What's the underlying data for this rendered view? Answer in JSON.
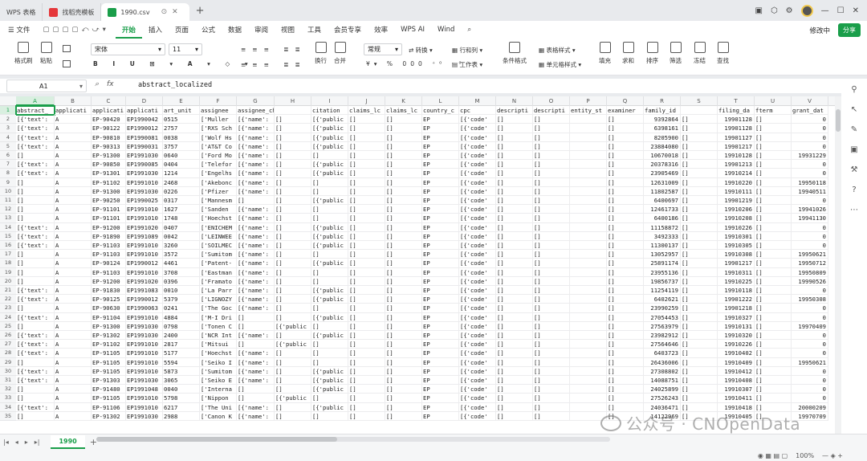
{
  "tabs": [
    {
      "label": "WPS 表格",
      "icon_color": "#e8eaed",
      "active": false
    },
    {
      "label": "找稻壳模板",
      "icon_color": "#e5383b",
      "active": false
    },
    {
      "label": "1990.csv",
      "icon_color": "#1a9e4a",
      "active": true
    }
  ],
  "new_tab": "+",
  "menu": {
    "file": "文件",
    "items": [
      "开始",
      "插入",
      "页面",
      "公式",
      "数据",
      "审阅",
      "视图",
      "工具",
      "会员专享",
      "效率",
      "WPS AI",
      "Wind"
    ],
    "active_index": 0,
    "edit_status": "修改中",
    "share": "分享"
  },
  "ribbon": {
    "groups": [
      "格式刷",
      "粘贴",
      "",
      "字体",
      "对齐",
      "换行",
      "合并",
      "常规",
      "转换",
      "行和列",
      "工作表",
      "条件格式",
      "表格样式",
      "单元格样式",
      "填充",
      "求和",
      "排序",
      "筛选",
      "冻结",
      "查找"
    ],
    "font_name": "宋体",
    "font_size": "11",
    "number_format": "常规",
    "convert": "转换"
  },
  "formula_bar": {
    "cell_ref": "A1",
    "formula": "abstract_localized"
  },
  "columns": [
    "A",
    "B",
    "C",
    "D",
    "E",
    "F",
    "G",
    "H",
    "I",
    "J",
    "K",
    "L",
    "M",
    "N",
    "O",
    "P",
    "Q",
    "R",
    "S",
    "T",
    "U",
    "V"
  ],
  "header_row": [
    "abstract_",
    "applicati",
    "applicati",
    "applicati",
    "art_unit",
    "assignee",
    "assignee_child",
    "",
    "citation",
    "claims_lc",
    "claims_lc",
    "country_c",
    "cpc",
    "descripti",
    "descripti",
    "entity_st",
    "examiner",
    "family_id",
    "",
    "filing_da",
    "fterm",
    "grant_dat"
  ],
  "rows": [
    [
      "[{'text':",
      "A",
      "EP-90420",
      "EP1990042",
      "0515",
      "['Muller",
      "[{'name':",
      "[]",
      "[{'public",
      "[]",
      "[]",
      "EP",
      "[{'code'",
      "[]",
      "[]",
      "",
      "[]",
      "9392864",
      "[]",
      "19901128",
      "[]",
      "0"
    ],
    [
      "[{'text':",
      "A",
      "EP-90122",
      "EP1990012",
      "2757",
      "['RXS Sch",
      "[{'name':",
      "[]",
      "[{'public",
      "[]",
      "[]",
      "EP",
      "[{'code'",
      "[]",
      "[]",
      "",
      "[]",
      "6398161",
      "[]",
      "19901128",
      "[]",
      "0"
    ],
    [
      "[{'text':",
      "A",
      "EP-90810",
      "EP1990081",
      "0038",
      "['Wolf Hs",
      "[{'name':",
      "[]",
      "[{'public",
      "[]",
      "[]",
      "EP",
      "[{'code'",
      "[]",
      "[]",
      "",
      "[]",
      "8205900",
      "[]",
      "19901127",
      "[]",
      "0"
    ],
    [
      "[{'text':",
      "A",
      "EP-90313",
      "EP1990031",
      "3757",
      "['AT&T Co",
      "[{'name':",
      "[]",
      "[{'public",
      "[]",
      "[]",
      "EP",
      "[{'code'",
      "[]",
      "[]",
      "",
      "[]",
      "23884080",
      "[]",
      "19901217",
      "[]",
      "0"
    ],
    [
      "[]",
      "A",
      "EP-91300",
      "EP1991030",
      "0640",
      "['Ford Mo",
      "[{'name':",
      "[]",
      "[]",
      "[]",
      "[]",
      "EP",
      "[{'code'",
      "[]",
      "[]",
      "",
      "[]",
      "10670018",
      "[]",
      "19910128",
      "[]",
      "19931229"
    ],
    [
      "[{'text':",
      "A",
      "EP-90850",
      "EP1990085",
      "0404",
      "['Telefor",
      "[{'name':",
      "[]",
      "[{'public",
      "[]",
      "[]",
      "EP",
      "[{'code'",
      "[]",
      "[]",
      "",
      "[]",
      "20378316",
      "[]",
      "19901213",
      "[]",
      "0"
    ],
    [
      "[{'text':",
      "A",
      "EP-91301",
      "EP1991030",
      "1214",
      "['Engelhs",
      "[{'name':",
      "[]",
      "[{'public",
      "[]",
      "[]",
      "EP",
      "[{'code'",
      "[]",
      "[]",
      "",
      "[]",
      "23905469",
      "[]",
      "19910214",
      "[]",
      "0"
    ],
    [
      "[]",
      "A",
      "EP-91102",
      "EP1991010",
      "2468",
      "['Akebonc",
      "[{'name':",
      "[]",
      "[]",
      "[]",
      "[]",
      "EP",
      "[{'code'",
      "[]",
      "[]",
      "",
      "[]",
      "12631009",
      "[]",
      "19910220",
      "[]",
      "19950118"
    ],
    [
      "[]",
      "A",
      "EP-91300",
      "EP1991030",
      "0226",
      "['Pfizer",
      "[{'name':",
      "[]",
      "[]",
      "[]",
      "[]",
      "EP",
      "[{'code'",
      "[]",
      "[]",
      "",
      "[]",
      "11802587",
      "[]",
      "19910111",
      "[]",
      "19940511"
    ],
    [
      "[]",
      "A",
      "EP-90250",
      "EP1990025",
      "0317",
      "['Mannesm",
      "[]",
      "[]",
      "[{'public",
      "[]",
      "[]",
      "EP",
      "[{'code'",
      "[]",
      "[]",
      "",
      "[]",
      "6400697",
      "[]",
      "19901219",
      "[]",
      "0"
    ],
    [
      "[]",
      "A",
      "EP-91101",
      "EP1991010",
      "1627",
      "['Sanden",
      "[{'name':",
      "[]",
      "[]",
      "[]",
      "[]",
      "EP",
      "[{'code'",
      "[]",
      "[]",
      "",
      "[]",
      "12461733",
      "[]",
      "19910206",
      "[]",
      "19941026"
    ],
    [
      "[]",
      "A",
      "EP-91101",
      "EP1991010",
      "1748",
      "['Hoechst",
      "[{'name':",
      "[]",
      "[]",
      "[]",
      "[]",
      "EP",
      "[{'code'",
      "[]",
      "[]",
      "",
      "[]",
      "6400186",
      "[]",
      "19910208",
      "[]",
      "19941130"
    ],
    [
      "[{'text':",
      "A",
      "EP-91200",
      "EP1991020",
      "0407",
      "['ENICHEM",
      "[{'name':",
      "[]",
      "[{'public",
      "[]",
      "[]",
      "EP",
      "[{'code'",
      "[]",
      "[]",
      "",
      "[]",
      "11158872",
      "[]",
      "19910226",
      "[]",
      "0"
    ],
    [
      "[{'text':",
      "A",
      "EP-91890",
      "EP1991089",
      "0042",
      "['LEINWEE",
      "[{'name':",
      "[]",
      "[{'public",
      "[]",
      "[]",
      "EP",
      "[{'code'",
      "[]",
      "[]",
      "",
      "[]",
      "3492333",
      "[]",
      "19910301",
      "[]",
      "0"
    ],
    [
      "[{'text':",
      "A",
      "EP-91103",
      "EP1991010",
      "3260",
      "['SOILMEC",
      "[{'name':",
      "[]",
      "[{'public",
      "[]",
      "[]",
      "EP",
      "[{'code'",
      "[]",
      "[]",
      "",
      "[]",
      "11300137",
      "[]",
      "19910305",
      "[]",
      "0"
    ],
    [
      "[]",
      "A",
      "EP-91103",
      "EP1991010",
      "3572",
      "['Sumitom",
      "[{'name':",
      "[]",
      "[]",
      "[]",
      "[]",
      "EP",
      "[{'code'",
      "[]",
      "[]",
      "",
      "[]",
      "13052957",
      "[]",
      "19910308",
      "[]",
      "19950621"
    ],
    [
      "[]",
      "A",
      "EP-90124",
      "EP1990012",
      "4461",
      "['Patent-",
      "[{'name':",
      "[]",
      "[{'public",
      "[]",
      "[]",
      "EP",
      "[{'code'",
      "[]",
      "[]",
      "",
      "[]",
      "25891174",
      "[]",
      "19901217",
      "[]",
      "19950712"
    ],
    [
      "[]",
      "A",
      "EP-91103",
      "EP1991010",
      "3708",
      "['Eastman",
      "[{'name':",
      "[]",
      "[]",
      "[]",
      "[]",
      "EP",
      "[{'code'",
      "[]",
      "[]",
      "",
      "[]",
      "23955136",
      "[]",
      "19910311",
      "[]",
      "19950809"
    ],
    [
      "[]",
      "A",
      "EP-91200",
      "EP1991020",
      "0396",
      "['Framato",
      "[{'name':",
      "[]",
      "[]",
      "[]",
      "[]",
      "EP",
      "[{'code'",
      "[]",
      "[]",
      "",
      "[]",
      "19856737",
      "[]",
      "19910225",
      "[]",
      "19990526"
    ],
    [
      "[{'text':",
      "A",
      "EP-91830",
      "EP1991083",
      "0010",
      "['La Parr",
      "[{'name':",
      "[]",
      "[{'public",
      "[]",
      "[]",
      "EP",
      "[{'code'",
      "[]",
      "[]",
      "",
      "[]",
      "11254119",
      "[]",
      "19910118",
      "[]",
      "0"
    ],
    [
      "[{'text':",
      "A",
      "EP-90125",
      "EP1990012",
      "5379",
      "['LIGNOZY",
      "[{'name':",
      "[]",
      "[{'public",
      "[]",
      "[]",
      "EP",
      "[{'code'",
      "[]",
      "[]",
      "",
      "[]",
      "6402621",
      "[]",
      "19901222",
      "[]",
      "19950308"
    ],
    [
      "[]",
      "A",
      "EP-90630",
      "EP1990063",
      "0241",
      "['The Goc",
      "[{'name':",
      "[]",
      "[]",
      "[]",
      "[]",
      "EP",
      "[{'code'",
      "[]",
      "[]",
      "",
      "[]",
      "23990259",
      "[]",
      "19901218",
      "[]",
      "0"
    ],
    [
      "[{'text':",
      "A",
      "EP-91104",
      "EP1991010",
      "4884",
      "['M-I Dri",
      "[]",
      "[]",
      "[{'public",
      "[]",
      "[]",
      "EP",
      "[{'code'",
      "[]",
      "[]",
      "",
      "[]",
      "27054453",
      "[]",
      "19910327",
      "[]",
      "0"
    ],
    [
      "[]",
      "A",
      "EP-91300",
      "EP1991030",
      "0798",
      "['Tonen C",
      "[]",
      "[{'public",
      "[]",
      "[]",
      "[]",
      "EP",
      "[{'code'",
      "[]",
      "[]",
      "",
      "[]",
      "27563979",
      "[]",
      "19910131",
      "[]",
      "19970409"
    ],
    [
      "[{'text':",
      "A",
      "EP-91302",
      "EP1991030",
      "2400",
      "['NCR Int",
      "[{'name':",
      "[]",
      "[{'public",
      "[]",
      "[]",
      "EP",
      "[{'code'",
      "[]",
      "[]",
      "",
      "[]",
      "23982912",
      "[]",
      "19910320",
      "[]",
      "0"
    ],
    [
      "[{'text':",
      "A",
      "EP-91102",
      "EP1991010",
      "2817",
      "['Mitsui",
      "[]",
      "[{'public",
      "[]",
      "[]",
      "[]",
      "EP",
      "[{'code'",
      "[]",
      "[]",
      "",
      "[]",
      "27564646",
      "[]",
      "19910226",
      "[]",
      "0"
    ],
    [
      "[{'text':",
      "A",
      "EP-91105",
      "EP1991010",
      "5177",
      "['Hoechst",
      "[{'name':",
      "[]",
      "[]",
      "[]",
      "[]",
      "EP",
      "[{'code'",
      "[]",
      "[]",
      "",
      "[]",
      "6403723",
      "[]",
      "19910402",
      "[]",
      "0"
    ],
    [
      "[]",
      "A",
      "EP-91105",
      "EP1991010",
      "5594",
      "['Seiko I",
      "[{'name':",
      "[]",
      "[]",
      "[]",
      "[]",
      "EP",
      "[{'code'",
      "[]",
      "[]",
      "",
      "[]",
      "26436006",
      "[]",
      "19910409",
      "[]",
      "19950621"
    ],
    [
      "[{'text':",
      "A",
      "EP-91105",
      "EP1991010",
      "5873",
      "['Sumitom",
      "[{'name':",
      "[]",
      "[{'public",
      "[]",
      "[]",
      "EP",
      "[{'code'",
      "[]",
      "[]",
      "",
      "[]",
      "27308802",
      "[]",
      "19910412",
      "[]",
      "0"
    ],
    [
      "[{'text':",
      "A",
      "EP-91303",
      "EP1991030",
      "3065",
      "['Seiko E",
      "[{'name':",
      "[]",
      "[{'public",
      "[]",
      "[]",
      "EP",
      "[{'code'",
      "[]",
      "[]",
      "",
      "[]",
      "14088751",
      "[]",
      "19910408",
      "[]",
      "0"
    ],
    [
      "[]",
      "A",
      "EP-91480",
      "EP1991048",
      "0040",
      "['Interna",
      "[]",
      "[]",
      "[{'public",
      "[]",
      "[]",
      "EP",
      "[{'code'",
      "[]",
      "[]",
      "",
      "[]",
      "24025899",
      "[]",
      "19910307",
      "[]",
      "0"
    ],
    [
      "[]",
      "A",
      "EP-91105",
      "EP1991010",
      "5798",
      "['Nippon",
      "[]",
      "[{'public",
      "[]",
      "[]",
      "[]",
      "EP",
      "[{'code'",
      "[]",
      "[]",
      "",
      "[]",
      "27526243",
      "[]",
      "19910411",
      "[]",
      "0"
    ],
    [
      "[{'text':",
      "A",
      "EP-91106",
      "EP1991010",
      "6217",
      "['The Uni",
      "[{'name':",
      "[]",
      "[{'public",
      "[]",
      "[]",
      "EP",
      "[{'code'",
      "[]",
      "[]",
      "",
      "[]",
      "24036471",
      "[]",
      "19910418",
      "[]",
      "20000209"
    ],
    [
      "[]",
      "A",
      "EP-91302",
      "EP1991030",
      "2988",
      "['Canon K",
      "[{'name':",
      "[]",
      "[]",
      "[]",
      "[]",
      "EP",
      "[{'code'",
      "[]",
      "[]",
      "",
      "[]",
      "14122969",
      "[]",
      "19910405",
      "[]",
      "19970709"
    ]
  ],
  "sheet_tab": "1990",
  "zoom": "100%",
  "watermark": "公众号 · CNOpenData"
}
